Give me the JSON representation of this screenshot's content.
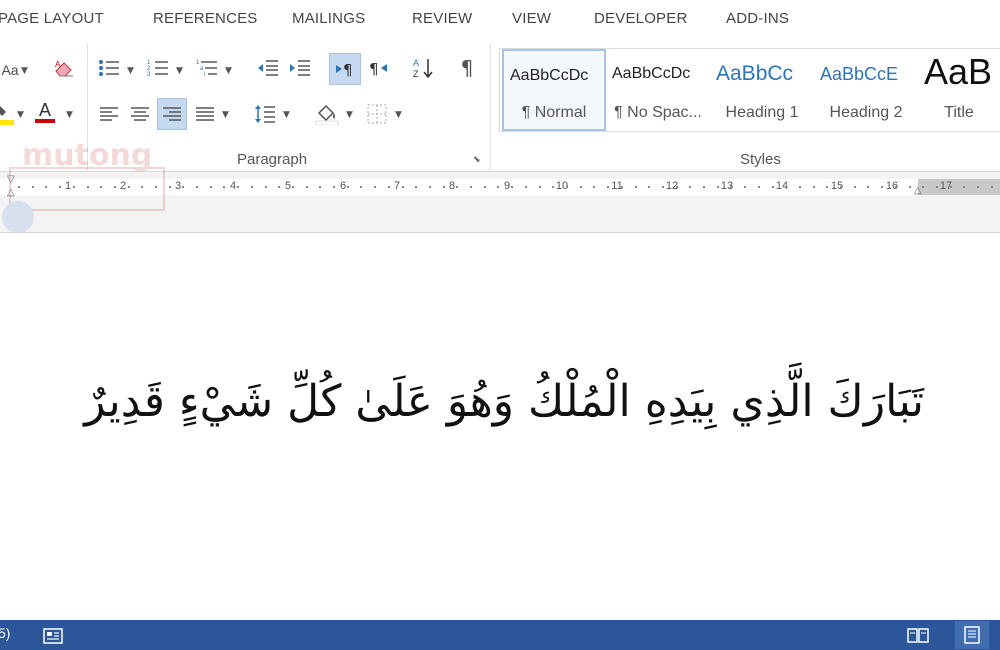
{
  "tabs": [
    "PAGE LAYOUT",
    "REFERENCES",
    "MAILINGS",
    "REVIEW",
    "VIEW",
    "DEVELOPER",
    "ADD-INS"
  ],
  "font_group": {
    "change_case_label": "Aa",
    "font_color_label": "A"
  },
  "paragraph_group": {
    "label": "Paragraph",
    "show_marks_glyph": "¶"
  },
  "styles_group": {
    "label": "Styles",
    "items": [
      {
        "preview": "AaBbCcDc",
        "name": "¶ Normal"
      },
      {
        "preview": "AaBbCcDc",
        "name": "¶ No Spac..."
      },
      {
        "preview": "AaBbCc",
        "name": "Heading 1"
      },
      {
        "preview": "AaBbCcE",
        "name": "Heading 2"
      },
      {
        "preview": "AaB",
        "name": "Title"
      }
    ]
  },
  "ruler": {
    "numbers": [
      "1",
      "2",
      "3",
      "4",
      "5",
      "6",
      "7",
      "8",
      "9",
      "10",
      "11",
      "12",
      "13",
      "14",
      "15",
      "16",
      "17"
    ]
  },
  "document": {
    "text": "تَبَارَكَ الَّذِي بِيَدِهِ الْمُلْكُ وَهُوَ عَلَىٰ كُلِّ شَيْءٍ قَدِيرٌ"
  },
  "statusbar": {
    "left_text": "5)"
  },
  "watermark": {
    "text": "mutong"
  },
  "colors": {
    "ribbon_bg": "#ffffff",
    "statusbar": "#2b579a",
    "selected_style_border": "#a7c3e8",
    "pressed_button": "#c5d9f1",
    "heading_blue": "#2e74b5",
    "font_color_red": "#d00000",
    "highlight_yellow": "#ffe600"
  },
  "icons": [
    "eraser-icon",
    "bullets-icon",
    "numbering-icon",
    "multilevel-list-icon",
    "decrease-indent-icon",
    "increase-indent-icon",
    "ltr-direction-icon",
    "rtl-direction-icon",
    "sort-icon",
    "pilcrow-icon",
    "highlighter-icon",
    "font-color-icon",
    "align-left-icon",
    "align-center-icon",
    "align-right-icon",
    "justify-icon",
    "line-spacing-icon",
    "shading-icon",
    "borders-icon",
    "read-mode-icon",
    "print-layout-icon",
    "macro-icon"
  ]
}
